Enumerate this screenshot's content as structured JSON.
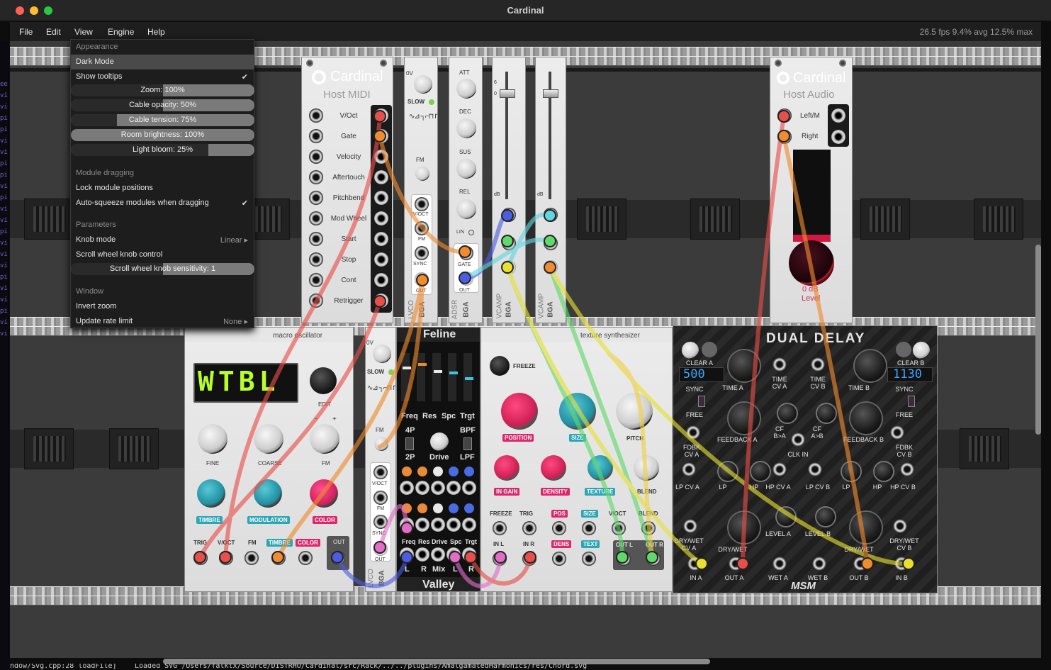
{
  "window": {
    "title": "Cardinal"
  },
  "menubar": {
    "items": [
      "File",
      "Edit",
      "View",
      "Engine",
      "Help"
    ],
    "fps": "26.5 fps  9.4% avg  12.5% max"
  },
  "view_menu": {
    "appearance_header": "Appearance",
    "dark_mode": "Dark Mode",
    "show_tooltips": "Show tooltips",
    "check": "✔",
    "sliders": [
      {
        "label": "Zoom: 100%",
        "value": 0.5
      },
      {
        "label": "Cable opacity: 50%",
        "value": 0.5
      },
      {
        "label": "Cable tension: 75%",
        "value": 0.75
      },
      {
        "label": "Room brightness: 100%",
        "value": 1.0
      },
      {
        "label": "Light bloom: 25%",
        "value": 0.25
      }
    ],
    "module_dragging_header": "Module dragging",
    "lock_module_positions": "Lock module positions",
    "auto_squeeze": "Auto-squeeze modules when dragging",
    "parameters_header": "Parameters",
    "knob_mode": "Knob mode",
    "knob_mode_value": "Linear",
    "scroll_wheel_knob_control": "Scroll wheel knob control",
    "scroll_sensitivity": {
      "label": "Scroll wheel knob sensitivity: 1",
      "value": 0.5
    },
    "window_header": "Window",
    "invert_zoom": "Invert zoom",
    "update_rate_limit": "Update rate limit",
    "update_rate_value": "None",
    "arrow": "▸"
  },
  "host_midi": {
    "brand": "Cardinal",
    "title": "Host MIDI",
    "outputs": [
      "V/Oct",
      "Gate",
      "Velocity",
      "Aftertouch",
      "Pitchbend",
      "Mod Wheel",
      "Start",
      "Stop",
      "Cont",
      "Retrigger"
    ]
  },
  "host_audio": {
    "brand": "Cardinal",
    "title": "Host Audio",
    "inputs": [
      "Left/M",
      "Right"
    ],
    "level_value": "0 dB",
    "level_label": "Level"
  },
  "lfo_top": {
    "labels": [
      "0V",
      "SLOW",
      "FM",
      "V/OCT",
      "FM",
      "SYNC",
      "OUT"
    ],
    "name": "LVCO",
    "brand": "BGA"
  },
  "adsr": {
    "labels": [
      "ATT",
      "DEC",
      "SUS",
      "REL",
      "LIN",
      "GATE",
      "OUT"
    ],
    "name": "ADSR",
    "brand": "BGA",
    "scale": [
      "5",
      "0",
      "5",
      "0",
      "5",
      "0",
      "5",
      "0"
    ]
  },
  "vcamp": {
    "labels": [
      "CV",
      "IN",
      "OUT"
    ],
    "name": "VCAMP",
    "brand": "BGA",
    "db_marks": [
      "6",
      "0",
      "-6",
      "-12",
      "-24",
      "-48",
      "dB"
    ]
  },
  "macro_osc": {
    "title": "macro oscillator",
    "display": "WTBL",
    "knob_labels": [
      "EDIT",
      "FINE",
      "COARSE",
      "FM",
      "TIMBRE",
      "MODULATION",
      "COLOR"
    ],
    "jacks": [
      "TRIG",
      "V/OCT",
      "FM",
      "TIMBRE",
      "COLOR",
      "OUT"
    ],
    "pm": [
      "−",
      "+"
    ]
  },
  "lfo_mid": {
    "labels": [
      "0V",
      "SLOW",
      "FM",
      "V/OCT",
      "FM",
      "SYNC",
      "OUT"
    ],
    "name": "LVCO",
    "brand": "BGA"
  },
  "feline": {
    "title": "Feline",
    "row1": [
      "Freq",
      "Res",
      "Spc",
      "Trgt"
    ],
    "modes": [
      "4P",
      "2P",
      "BPF",
      "LPF"
    ],
    "drive": "Drive",
    "row2": [
      "Freq",
      "Res",
      "Drive",
      "Spc",
      "Trgt"
    ],
    "row3": [
      "L",
      "R",
      "Mix",
      "L",
      "R"
    ],
    "brand": "Valley"
  },
  "texture": {
    "title": "texture synthesizer",
    "freeze": "FREEZE",
    "knobs": [
      "POSITION",
      "SIZE",
      "PITCH",
      "IN GAIN",
      "DENSITY",
      "TEXTURE",
      "BLEND"
    ],
    "jacks_top": [
      "FREEZE",
      "TRIG",
      "POS",
      "SIZE",
      "V/OCT",
      "BLEND"
    ],
    "jacks_bottom": [
      "IN L",
      "IN R",
      "DENS",
      "TEXT",
      "OUT L",
      "OUT R"
    ]
  },
  "dual_delay": {
    "title": "DUAL DELAY",
    "clear_a": "CLEAR A",
    "clear_b": "CLEAR B",
    "display_a": "500",
    "display_b": "1130",
    "labels": [
      "SYNC",
      "FREE",
      "TIME A",
      "TIME\nCV A",
      "TIME\nCV B",
      "TIME B",
      "SYNC",
      "FREE",
      "FDBK\nCV A",
      "FEEDBACK A",
      "CF\nB>A",
      "CF\nA>B",
      "FEEDBACK B",
      "FDBK\nCV B",
      "CLK IN",
      "LP CV A",
      "LP",
      "HP",
      "HP CV A",
      "LP CV B",
      "LP",
      "HP",
      "HP CV B",
      "LEVEL A",
      "LEVEL B",
      "DRY/WET\nCV A",
      "DRY/WET",
      "DRY/WET",
      "DRY/WET\nCV B",
      "IN A",
      "OUT A",
      "WET A",
      "WET B",
      "OUT B",
      "IN B"
    ],
    "brand": "MSM"
  },
  "status_line": "Loaded SVG /Users/falktx/Source/DISTRHO/Cardinal/src/Rack/../../plugins/AmalgamatedHarmonics/res/Chord.svg",
  "status_left": "ndow/Svg.cpp:28 loadFile]",
  "term_lines": [
    "ee",
    "vi",
    "vi",
    "pi",
    "pi",
    "vi",
    "vi",
    "pi",
    "pi",
    "vi",
    "pi",
    "vi",
    "vi",
    "pi",
    "vi",
    "vi",
    "vi",
    "pi",
    "vi",
    "vi",
    "pi",
    "vi",
    "vi"
  ],
  "colors": {
    "cable_red": "#e94f4a",
    "cable_orange": "#f08b2e",
    "cable_blue": "#4b5de0",
    "cable_cyan": "#5fd7e0",
    "cable_green": "#5fd96a",
    "cable_yellow": "#e8e030",
    "cable_pink": "#e36cc6",
    "accent_teal": "#2ba6b6",
    "accent_pink": "#e0256a"
  }
}
